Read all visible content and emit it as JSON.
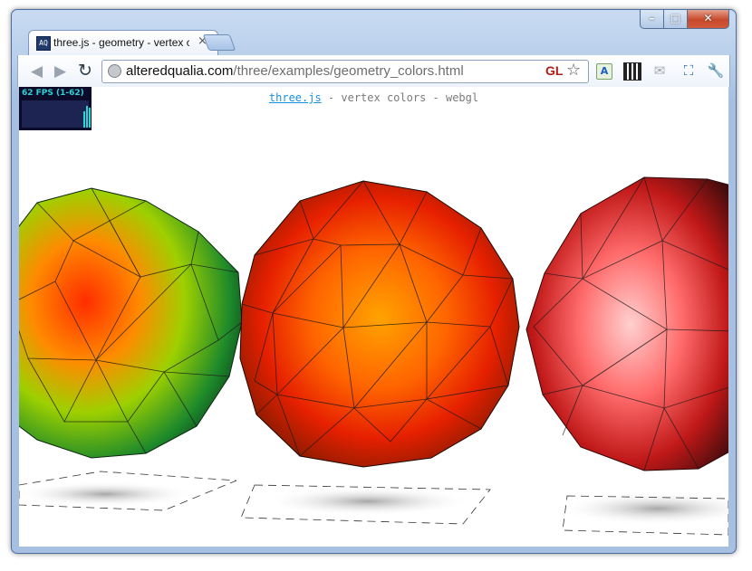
{
  "window": {
    "tab_title": "three.js - geometry - vertex colors",
    "favicon_text": "AQ",
    "controls": {
      "minimize": "–",
      "maximize": "□",
      "close": "✕"
    }
  },
  "toolbar": {
    "back_icon": "◀",
    "forward_icon": "▶",
    "reload_icon": "↻",
    "url_host": "alteredqualia.com",
    "url_path": "/three/examples/geometry_colors.html",
    "gl_badge": "GL",
    "bookmark_icon": "☆",
    "extensions": [
      "translate-icon",
      "qr-code-icon",
      "mail-icon",
      "screen-capture-icon",
      "wrench-icon"
    ]
  },
  "page": {
    "fps_label": "62 FPS (1-62)",
    "info_link": "three.js",
    "info_text": " - vertex colors - webgl"
  },
  "colors": {
    "accent": "#1a8fe0",
    "titlebar": "#b7cde9",
    "fps_bg": "#0a0a2a",
    "fps_text": "#2bd6d6"
  },
  "spheres": [
    {
      "name": "green-orange-sphere",
      "gradient": [
        "#ff3a00",
        "#ffa400",
        "#5fd200",
        "#0c2f10"
      ]
    },
    {
      "name": "orange-red-sphere",
      "gradient": [
        "#ffa000",
        "#ff5a00",
        "#e11b00",
        "#2a1200"
      ]
    },
    {
      "name": "pink-sphere",
      "gradient": [
        "#ffdede",
        "#ff6666",
        "#c21a1a",
        "#2c0808"
      ]
    }
  ]
}
